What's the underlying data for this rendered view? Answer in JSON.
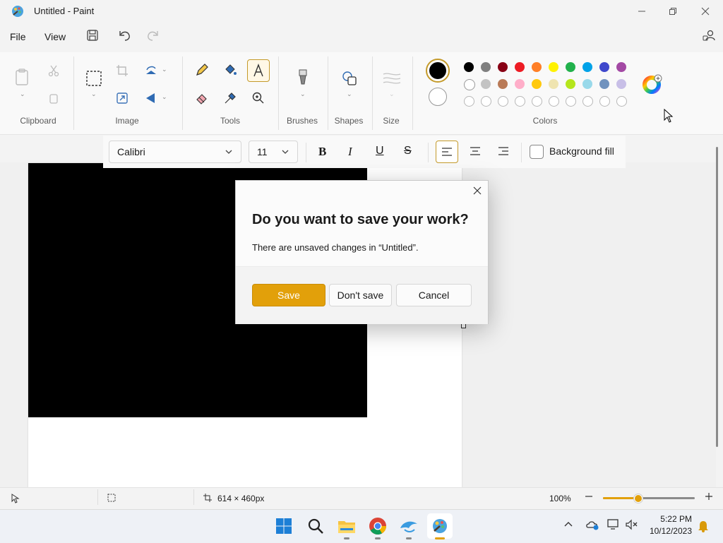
{
  "window": {
    "title": "Untitled - Paint"
  },
  "menu": {
    "file": "File",
    "view": "View"
  },
  "ribbon": {
    "groups": {
      "clipboard": "Clipboard",
      "image": "Image",
      "tools": "Tools",
      "brushes": "Brushes",
      "shapes": "Shapes",
      "size": "Size",
      "colors": "Colors"
    },
    "primary_color": "#000000",
    "secondary_color": "#ffffff",
    "palette_row1": [
      "#000000",
      "#7f7f7f",
      "#880015",
      "#ed1c24",
      "#ff7f27",
      "#fff200",
      "#22b14c",
      "#00a2e8",
      "#3f48cc",
      "#a349a4"
    ],
    "palette_row2": [
      "#ffffff",
      "#c3c3c3",
      "#b97a57",
      "#ffaec9",
      "#ffc90e",
      "#efe4b0",
      "#b5e61d",
      "#99d9ea",
      "#7092be",
      "#c8bfe7"
    ]
  },
  "text_toolbar": {
    "font_family": "Calibri",
    "font_size": "11",
    "background_fill_label": "Background fill"
  },
  "dialog": {
    "title": "Do you want to save your work?",
    "message": "There are unsaved changes in “Untitled”.",
    "save_label": "Save",
    "dont_save_label": "Don't save",
    "cancel_label": "Cancel",
    "accent": "#e2a00a"
  },
  "status": {
    "canvas_size": "614 × 460px",
    "zoom": "100%"
  },
  "taskbar": {
    "time": "5:22 PM",
    "date": "10/12/2023"
  }
}
